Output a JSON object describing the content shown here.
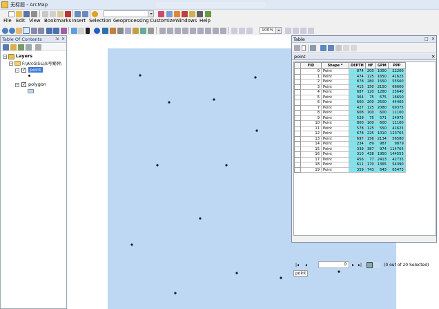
{
  "window": {
    "title": "无标题 - ArcMap"
  },
  "menu": [
    "File",
    "Edit",
    "View",
    "Bookmarks",
    "Insert",
    "Selection",
    "Geoprocessing",
    "Customize",
    "Windows",
    "Help"
  ],
  "toolbar": {
    "scale_value": "",
    "zoom_value": "100%"
  },
  "toc": {
    "title": "Table Of Contents",
    "layers_label": "Layers",
    "folder_label": "F:\\ArcGIS公众号案例\\",
    "layer_point": "point",
    "layer_polygon": "polygon"
  },
  "table_window": {
    "title": "Table",
    "tab_label": "point",
    "record_value": "0",
    "selection_text": "(0 out of 20 Selected)",
    "bottom_tab": "point"
  },
  "table": {
    "columns": [
      "FID",
      "Shape *",
      "DEPTH",
      "HF",
      "GPM",
      "PPP"
    ],
    "rows": [
      [
        "0",
        "Point",
        "874",
        "200",
        "1050",
        "22200"
      ],
      [
        "1",
        "Point",
        "474",
        "125",
        "1650",
        "41625"
      ],
      [
        "2",
        "Point",
        "878",
        "280",
        "1550",
        "55500"
      ],
      [
        "3",
        "Point",
        "415",
        "150",
        "2150",
        "66600"
      ],
      [
        "4",
        "Point",
        "687",
        "120",
        "1280",
        "25640"
      ],
      [
        "5",
        "Point",
        "364",
        "75",
        "675",
        "16650"
      ],
      [
        "6",
        "Point",
        "600",
        "200",
        "2500",
        "44400"
      ],
      [
        "7",
        "Point",
        "427",
        "125",
        "2080",
        "69375"
      ],
      [
        "8",
        "Point",
        "608",
        "100",
        "600",
        "11100"
      ],
      [
        "9",
        "Point",
        "528",
        "75",
        "571",
        "24975"
      ],
      [
        "10",
        "Point",
        "800",
        "100",
        "600",
        "11100"
      ],
      [
        "11",
        "Point",
        "578",
        "125",
        "550",
        "41625"
      ],
      [
        "12",
        "Point",
        "678",
        "225",
        "1010",
        "123765"
      ],
      [
        "13",
        "Point",
        "697",
        "156",
        "2134",
        "56580"
      ],
      [
        "14",
        "Point",
        "234",
        "89",
        "987",
        "9879"
      ],
      [
        "15",
        "Point",
        "339",
        "387",
        "974",
        "114765"
      ],
      [
        "16",
        "Point",
        "310",
        "438",
        "1950",
        "144555"
      ],
      [
        "17",
        "Point",
        "456",
        "77",
        "2413",
        "42735"
      ],
      [
        "18",
        "Point",
        "611",
        "170",
        "1365",
        "54390"
      ],
      [
        "19",
        "Point",
        "359",
        "743",
        "643",
        "65473"
      ]
    ]
  },
  "colors": {
    "polygon_fill": "#bed7f2",
    "highlight_columns": "#7fe4ed",
    "point": "#1a1a1a"
  }
}
